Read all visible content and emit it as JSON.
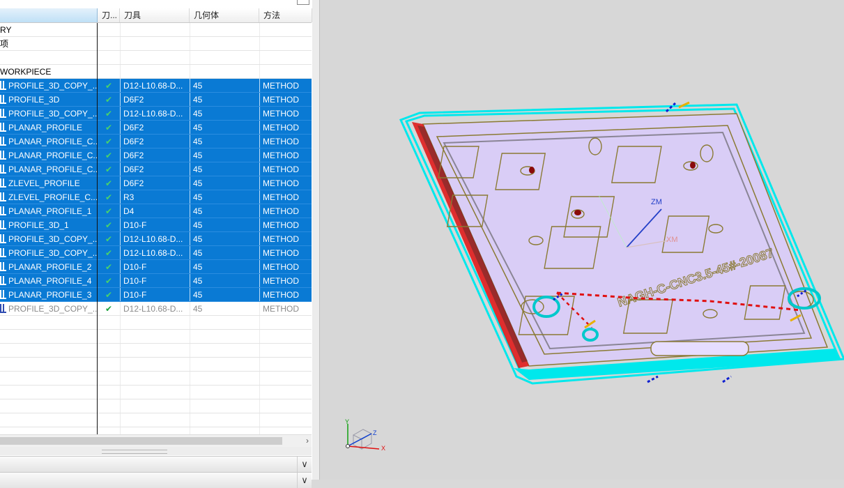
{
  "navigator": {
    "columns": {
      "name": "",
      "check": "刀...",
      "tool": "刀具",
      "geometry": "几何体",
      "method": "方法"
    },
    "rows": [
      {
        "name": "RY",
        "check": "",
        "tool": "",
        "geometry": "",
        "method": "",
        "state": "normal",
        "icon": false
      },
      {
        "name": "项",
        "check": "",
        "tool": "",
        "geometry": "",
        "method": "",
        "state": "normal",
        "icon": false
      },
      {
        "name": "",
        "check": "",
        "tool": "",
        "geometry": "",
        "method": "",
        "state": "normal",
        "icon": false
      },
      {
        "name": "WORKPIECE",
        "check": "",
        "tool": "",
        "geometry": "",
        "method": "",
        "state": "normal",
        "icon": false
      },
      {
        "name": "PROFILE_3D_COPY_...",
        "check": "✔",
        "tool": "D12-L10.68-D...",
        "geometry": "45",
        "method": "METHOD",
        "state": "selected",
        "icon": true
      },
      {
        "name": "PROFILE_3D",
        "check": "✔",
        "tool": "D6F2",
        "geometry": "45",
        "method": "METHOD",
        "state": "selected",
        "icon": true
      },
      {
        "name": "PROFILE_3D_COPY_...",
        "check": "✔",
        "tool": "D12-L10.68-D...",
        "geometry": "45",
        "method": "METHOD",
        "state": "selected",
        "icon": true
      },
      {
        "name": "PLANAR_PROFILE",
        "check": "✔",
        "tool": "D6F2",
        "geometry": "45",
        "method": "METHOD",
        "state": "selected",
        "icon": true
      },
      {
        "name": "PLANAR_PROFILE_C...",
        "check": "✔",
        "tool": "D6F2",
        "geometry": "45",
        "method": "METHOD",
        "state": "selected",
        "icon": true
      },
      {
        "name": "PLANAR_PROFILE_C...",
        "check": "✔",
        "tool": "D6F2",
        "geometry": "45",
        "method": "METHOD",
        "state": "selected",
        "icon": true
      },
      {
        "name": "PLANAR_PROFILE_C...",
        "check": "✔",
        "tool": "D6F2",
        "geometry": "45",
        "method": "METHOD",
        "state": "selected",
        "icon": true
      },
      {
        "name": "ZLEVEL_PROFILE",
        "check": "✔",
        "tool": "D6F2",
        "geometry": "45",
        "method": "METHOD",
        "state": "selected",
        "icon": true
      },
      {
        "name": "ZLEVEL_PROFILE_C...",
        "check": "✔",
        "tool": "R3",
        "geometry": "45",
        "method": "METHOD",
        "state": "selected",
        "icon": true
      },
      {
        "name": "PLANAR_PROFILE_1",
        "check": "✔",
        "tool": "D4",
        "geometry": "45",
        "method": "METHOD",
        "state": "selected",
        "icon": true
      },
      {
        "name": "PROFILE_3D_1",
        "check": "✔",
        "tool": "D10-F",
        "geometry": "45",
        "method": "METHOD",
        "state": "selected",
        "icon": true
      },
      {
        "name": "PROFILE_3D_COPY_...",
        "check": "✔",
        "tool": "D12-L10.68-D...",
        "geometry": "45",
        "method": "METHOD",
        "state": "selected",
        "icon": true
      },
      {
        "name": "PROFILE_3D_COPY_...",
        "check": "✔",
        "tool": "D12-L10.68-D...",
        "geometry": "45",
        "method": "METHOD",
        "state": "selected",
        "icon": true
      },
      {
        "name": "PLANAR_PROFILE_2",
        "check": "✔",
        "tool": "D10-F",
        "geometry": "45",
        "method": "METHOD",
        "state": "selected",
        "icon": true
      },
      {
        "name": "PLANAR_PROFILE_4",
        "check": "✔",
        "tool": "D10-F",
        "geometry": "45",
        "method": "METHOD",
        "state": "selected",
        "icon": true
      },
      {
        "name": "PLANAR_PROFILE_3",
        "check": "✔",
        "tool": "D10-F",
        "geometry": "45",
        "method": "METHOD",
        "state": "selected",
        "icon": true
      },
      {
        "name": "PROFILE_3D_COPY_...",
        "check": "✔",
        "tool": "D12-L10.68-D...",
        "geometry": "45",
        "method": "METHOD",
        "state": "dim",
        "icon": true
      },
      {
        "name": "",
        "check": "",
        "tool": "",
        "geometry": "",
        "method": "",
        "state": "normal",
        "icon": false
      },
      {
        "name": "",
        "check": "",
        "tool": "",
        "geometry": "",
        "method": "",
        "state": "normal",
        "icon": false
      },
      {
        "name": "",
        "check": "",
        "tool": "",
        "geometry": "",
        "method": "",
        "state": "normal",
        "icon": false
      },
      {
        "name": "",
        "check": "",
        "tool": "",
        "geometry": "",
        "method": "",
        "state": "normal",
        "icon": false
      },
      {
        "name": "",
        "check": "",
        "tool": "",
        "geometry": "",
        "method": "",
        "state": "normal",
        "icon": false
      },
      {
        "name": "",
        "check": "",
        "tool": "",
        "geometry": "",
        "method": "",
        "state": "normal",
        "icon": false
      },
      {
        "name": "",
        "check": "",
        "tool": "",
        "geometry": "",
        "method": "",
        "state": "normal",
        "icon": false
      },
      {
        "name": "",
        "check": "",
        "tool": "",
        "geometry": "",
        "method": "",
        "state": "normal",
        "icon": false
      },
      {
        "name": "",
        "check": "",
        "tool": "",
        "geometry": "",
        "method": "",
        "state": "normal",
        "icon": false
      }
    ],
    "scroll_right_glyph": "›",
    "dropdown_glyph": "∨"
  },
  "viewport": {
    "wcs_labels": {
      "zm": "ZM",
      "xm": "XM"
    },
    "engraved_text": "NAGH-C-CNC3.5-45#-20087",
    "triad_labels": {
      "x": "X",
      "y": "Y",
      "z": "Z"
    },
    "colors": {
      "background": "#d7d7d7",
      "part_face": "#d9cdf6",
      "part_outline": "#8a7a33",
      "toolpath_cyan": "#00e8ec",
      "toolpath_red": "#e01010",
      "selection_blue": "#0a7ad4",
      "wcs_axis": "#2440c8"
    }
  }
}
